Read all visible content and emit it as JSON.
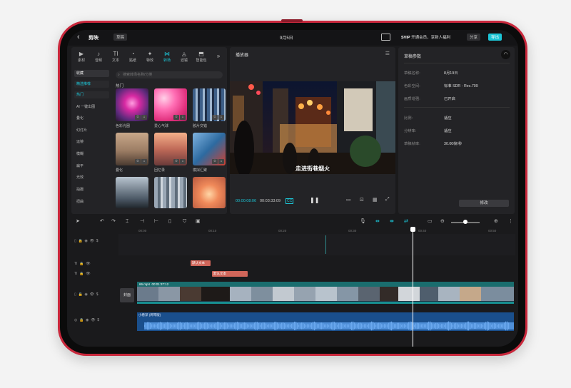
{
  "topbar": {
    "back_icon": "chevron-left-icon",
    "logo": "剪映",
    "draft_label": "草稿",
    "date": "9月5日",
    "vip_text": "开通会员，享新人福利",
    "vip_badge": "SVIP",
    "share_label": "分享",
    "export_label": "导出"
  },
  "library": {
    "tools": [
      {
        "label": "素材",
        "icon": "▶"
      },
      {
        "label": "音频",
        "icon": "♪"
      },
      {
        "label": "文本",
        "icon": "TI"
      },
      {
        "label": "贴纸",
        "icon": "◔"
      },
      {
        "label": "特效",
        "icon": "✦"
      },
      {
        "label": "转场",
        "icon": "⋈"
      },
      {
        "label": "滤镜",
        "icon": "◬"
      },
      {
        "label": "智能包",
        "icon": "⬒"
      },
      {
        "label": "»",
        "icon": ""
      }
    ],
    "categories": [
      "收藏",
      "精选推荐",
      "热门",
      "AI 一键出图",
      "叠化",
      "幻灯片",
      "运镜",
      "模糊",
      "扁平",
      "光效",
      "拍摄",
      "扭曲"
    ],
    "search_placeholder": "搜索转场名称/分类",
    "section_title": "热门",
    "items": [
      {
        "label": "色彩光圈"
      },
      {
        "label": "爱心气球"
      },
      {
        "label": "胶片交错"
      },
      {
        "label": "叠化"
      },
      {
        "label": "回忆录"
      },
      {
        "label": "模拟汇聚"
      },
      {
        "label": ""
      },
      {
        "label": ""
      },
      {
        "label": ""
      }
    ]
  },
  "player": {
    "title": "播放器",
    "subtitle": "走进街巷烟火",
    "current_time": "00:00:08:06",
    "total_time": "00:03:33:09",
    "cc_label": "CC"
  },
  "params": {
    "title": "草稿参数",
    "rows": [
      {
        "label": "草稿名称:",
        "value": "8月19日"
      },
      {
        "label": "色彩空间:",
        "value": "标准 SDR - Rec.709"
      },
      {
        "label": "画质增强:",
        "value": "已开启"
      },
      {
        "label": "比例:",
        "value": "适应"
      },
      {
        "label": "分辨率:",
        "value": "适应"
      },
      {
        "label": "草稿帧率:",
        "value": "30.00帧/秒"
      }
    ],
    "modify_label": "修改"
  },
  "timeline": {
    "ruler": [
      "00:00",
      "00:10",
      "00:20",
      "00:30",
      "00:40",
      "00:50"
    ],
    "text_clips": [
      "默认文本",
      "默认文本"
    ],
    "video_clip_name": "66.mp4",
    "video_clip_duration": "00:01:37:12",
    "cover_label": "封面",
    "audio_clip_name": "小巷深 (简琴版)"
  }
}
